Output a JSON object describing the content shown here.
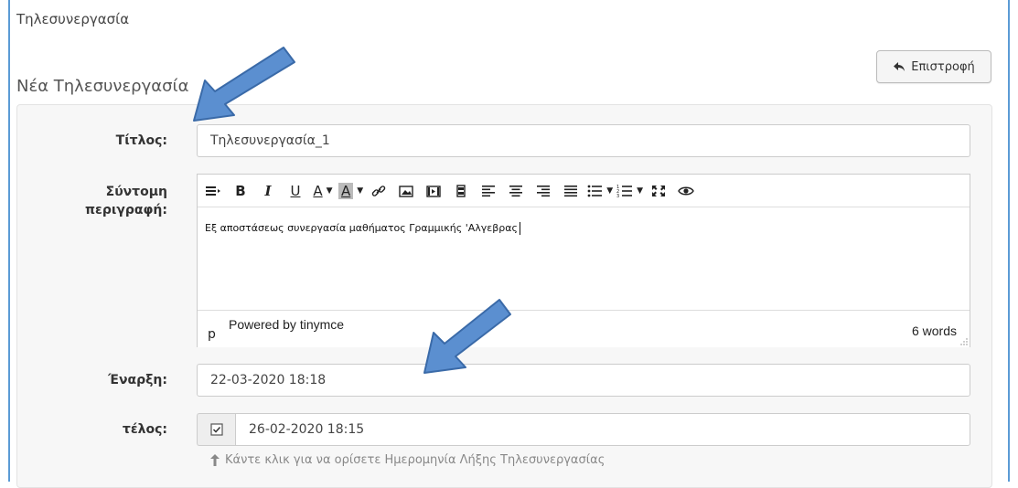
{
  "header": {
    "breadcrumb": "Τηλεσυνεργασία",
    "page_title": "Νέα Τηλεσυνεργασία",
    "back_label": "Επιστροφή"
  },
  "form": {
    "title_label": "Τίτλος:",
    "title_value": "Τηλεσυνεργασία_1",
    "desc_label_line1": "Σύντομη",
    "desc_label_line2": "περιγραφή:",
    "editor": {
      "content": "Εξ αποστάσεως συνεργασία μαθήματος Γραμμικής 'Αλγεβρας",
      "status_path": "p",
      "powered_by": "Powered by tinymce",
      "word_count": "6 words",
      "toolbar": [
        "formats-icon",
        "bold-icon",
        "italic-icon",
        "underline-icon",
        "text-color-icon",
        "background-color-icon",
        "link-icon",
        "image-icon",
        "media-icon",
        "film-icon",
        "align-left-icon",
        "align-center-icon",
        "align-right-icon",
        "align-justify-icon",
        "bullet-list-icon",
        "numbered-list-icon",
        "fullscreen-icon",
        "preview-icon"
      ]
    },
    "start_label": "Έναρξη:",
    "start_value": "22-03-2020 18:18",
    "end_label": "τέλος:",
    "end_checked": true,
    "end_value": "26-02-2020 18:15",
    "end_help": "Κάντε κλικ για να ορίσετε Ημερομηνία Λήξης Τηλεσυνεργασίας"
  },
  "colors": {
    "frame_border": "#5b9bd5",
    "arrow_fill": "#5b8fd0",
    "arrow_stroke": "#3a6aa8",
    "panel_bg": "#f7f7f7"
  }
}
